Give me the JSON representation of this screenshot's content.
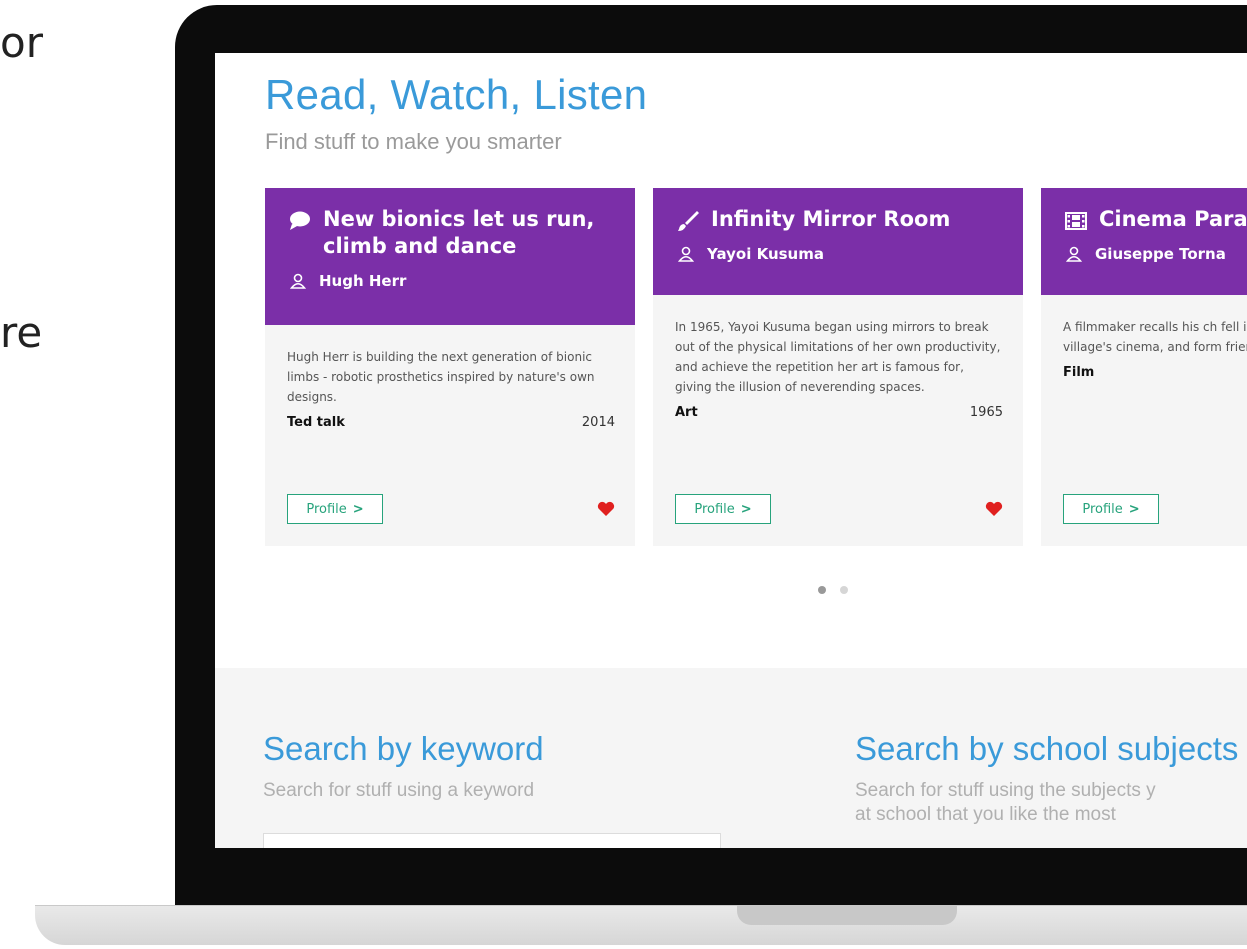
{
  "background_text": [
    "or",
    "re"
  ],
  "hero": {
    "title": "Read, Watch, Listen",
    "subtitle": "Find stuff to make you smarter"
  },
  "cards": [
    {
      "icon": "speech-bubble-icon",
      "title_lines": [
        "New bionics let us run,",
        "climb and dance"
      ],
      "author": "Hugh Herr",
      "description": "Hugh Herr is building the next generation of bionic limbs - robotic prosthetics inspired by nature's own designs.",
      "type": "Ted talk",
      "year": "2014",
      "button": "Profile",
      "button_chevron": ">"
    },
    {
      "icon": "paintbrush-icon",
      "title_lines": [
        "Infinity Mirror Room"
      ],
      "author": "Yayoi Kusuma",
      "description": "In 1965, Yayoi Kusuma began using mirrors to break out of the physical limitations of her own productivity, and achieve the repetition her art is famous for, giving the illusion of neverending spaces.",
      "type": "Art",
      "year": "1965",
      "button": "Profile",
      "button_chevron": ">"
    },
    {
      "icon": "film-icon",
      "title_lines": [
        "Cinema Para"
      ],
      "author": "Giuseppe Torna",
      "description": "A filmmaker recalls his ch fell in love with the pictur village's cinema, and form friendship with the cinem",
      "type": "Film",
      "year": "",
      "button": "Profile",
      "button_chevron": ">"
    }
  ],
  "carousel": {
    "dot_count": 2,
    "active": 0
  },
  "search_keyword": {
    "title": "Search by keyword",
    "subtitle": "Search for stuff using a keyword"
  },
  "search_subjects": {
    "title": "Search by school subjects",
    "subtitle_lines": [
      "Search for stuff using the subjects y",
      "at school that you like the most"
    ]
  },
  "colors": {
    "accent_blue": "#3a9ad9",
    "card_purple": "#7b2fa8",
    "button_green": "#27a37c",
    "heart_red": "#e0201f"
  }
}
